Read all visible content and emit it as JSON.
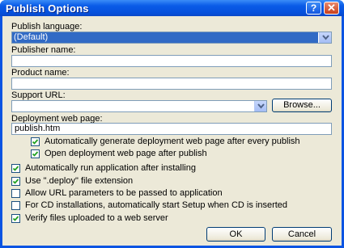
{
  "window": {
    "title": "Publish Options",
    "help_glyph": "?",
    "close_glyph": "✕"
  },
  "publish_language": {
    "label": "Publish language:",
    "value": "(Default)"
  },
  "publisher_name": {
    "label": "Publisher name:",
    "value": ""
  },
  "product_name": {
    "label": "Product name:",
    "value": ""
  },
  "support_url": {
    "label": "Support URL:",
    "value": "",
    "browse_label": "Browse..."
  },
  "deployment_page": {
    "label": "Deployment web page:",
    "value": "publish.htm"
  },
  "checkboxes": [
    {
      "label": "Automatically generate deployment web page after every publish",
      "checked": true
    },
    {
      "label": "Open deployment web page after publish",
      "checked": true
    },
    {
      "label": "Automatically run application after installing",
      "checked": true
    },
    {
      "label": "Use \".deploy\" file extension",
      "checked": true
    },
    {
      "label": "Allow URL parameters to be passed to application",
      "checked": false
    },
    {
      "label": "For CD installations, automatically start Setup when CD is inserted",
      "checked": false
    },
    {
      "label": "Verify files uploaded to a web server",
      "checked": true
    }
  ],
  "buttons": {
    "ok": "OK",
    "cancel": "Cancel"
  }
}
